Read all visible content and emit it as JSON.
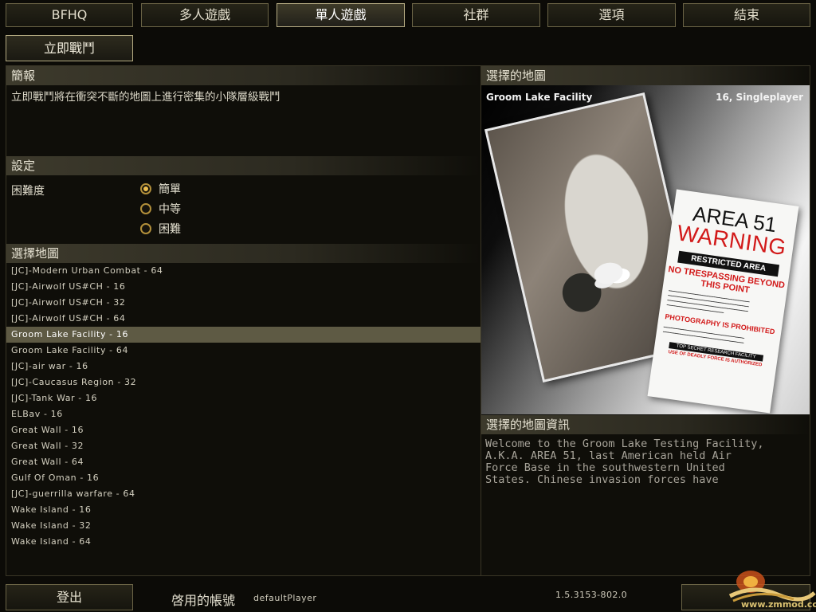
{
  "top_nav": [
    "BFHQ",
    "多人遊戲",
    "單人遊戲",
    "社群",
    "選項",
    "結束"
  ],
  "sub_nav": {
    "instant_battle": "立即戰鬥"
  },
  "briefing": {
    "heading": "簡報",
    "text": "立即戰鬥將在衝突不斷的地圖上進行密集的小隊層級戰鬥"
  },
  "settings": {
    "heading": "設定",
    "difficulty_label": "困難度",
    "options": [
      "簡單",
      "中等",
      "困難"
    ],
    "selected": "簡單"
  },
  "map_select": {
    "heading": "選擇地圖",
    "maps": [
      "[JC]-Modern Urban Combat - 64",
      "[JC]-Airwolf US#CH - 16",
      "[JC]-Airwolf US#CH - 32",
      "[JC]-Airwolf US#CH - 64",
      "Groom Lake Facility - 16",
      "Groom Lake Facility - 64",
      "[JC]-air war - 16",
      "[JC]-Caucasus Region - 32",
      "[JC]-Tank War - 16",
      "ELBav - 16",
      "Great Wall - 16",
      "Great Wall - 32",
      "Great Wall - 64",
      "Gulf Of Oman - 16",
      "[JC]-guerrilla warfare - 64",
      "Wake Island - 16",
      "Wake Island - 32",
      "Wake Island - 64"
    ],
    "selected": "Groom Lake Facility - 16"
  },
  "selected_map": {
    "heading": "選擇的地圖",
    "name": "Groom Lake Facility",
    "info": "16, Singleplayer",
    "sign": {
      "line1": "AREA 51",
      "line2": "WARNING",
      "restricted": "RESTRICTED AREA",
      "no_trespassing": "NO TRESPASSING BEYOND THIS POINT",
      "photography": "PHOTOGRAPHY IS PROHIBITED",
      "top_secret": "TOP SECRET RESEARCH FACILITY",
      "deadly_force": "USE OF DEADLY FORCE IS AUTHORIZED"
    }
  },
  "map_info": {
    "heading": "選擇的地圖資訊",
    "text": "Welcome to the Groom Lake Testing Facility,\nA.K.A. AREA 51, last American held Air\nForce Base in the southwestern United\nStates. Chinese invasion forces have"
  },
  "footer": {
    "logout": "登出",
    "account_label": "啓用的帳號",
    "account_name": "defaultPlayer",
    "version": "1.5.3153-802.0",
    "watermark": "www.zmmod.com"
  },
  "colors": {
    "accent_radio": "#f0c050",
    "selected_row": "#5e5a44",
    "header_bar": "#3d3a2c"
  }
}
